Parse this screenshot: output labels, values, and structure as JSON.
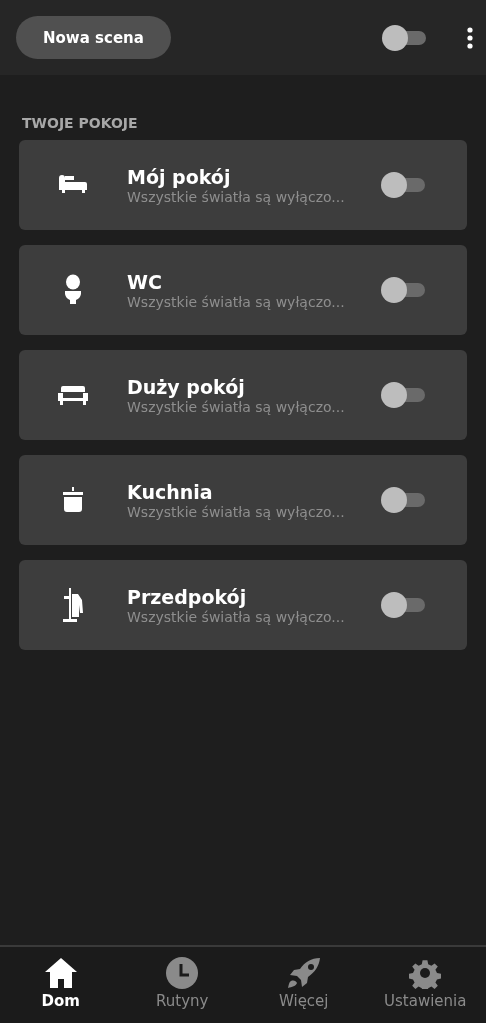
{
  "header": {
    "new_scene_button": "Nowa scena",
    "master_toggle": {
      "on": false
    }
  },
  "section_title": "TWOJE POKOJE",
  "rooms": [
    {
      "kind": "bed",
      "name": "Mój pokój",
      "status": "Wszystkie światła są wyłączo...",
      "on": false
    },
    {
      "kind": "toilet",
      "name": "WC",
      "status": "Wszystkie światła są wyłączo...",
      "on": false
    },
    {
      "kind": "sofa",
      "name": "Duży pokój",
      "status": "Wszystkie światła są wyłączo...",
      "on": false
    },
    {
      "kind": "pot",
      "name": "Kuchnia",
      "status": "Wszystkie światła są wyłączo...",
      "on": false
    },
    {
      "kind": "coatrack",
      "name": "Przedpokój",
      "status": "Wszystkie światła są wyłączo...",
      "on": false
    }
  ],
  "nav": [
    {
      "kind": "home",
      "label": "Dom",
      "selected": true
    },
    {
      "kind": "clock",
      "label": "Rutyny",
      "selected": false
    },
    {
      "kind": "rocket",
      "label": "Więcej",
      "selected": false
    },
    {
      "kind": "gear",
      "label": "Ustawienia",
      "selected": false
    }
  ]
}
